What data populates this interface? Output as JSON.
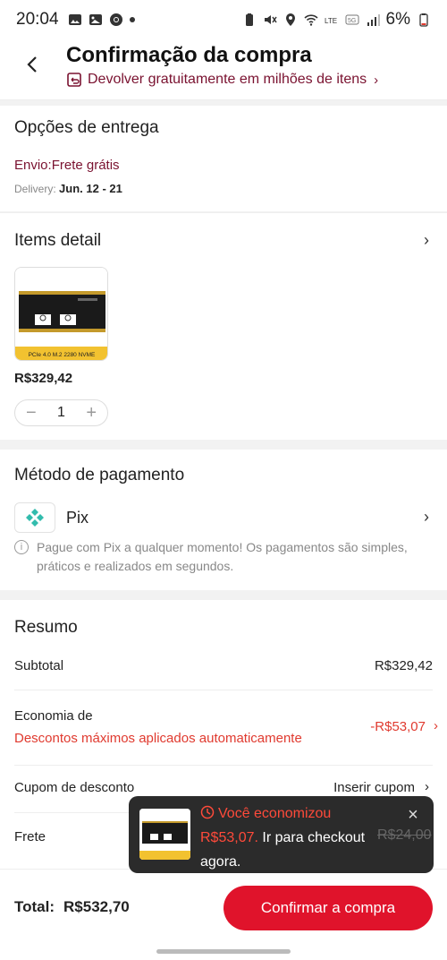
{
  "status_bar": {
    "time": "20:04",
    "battery": "6%"
  },
  "header": {
    "title": "Confirmação da compra",
    "return_text": "Devolver gratuitamente em milhões de itens"
  },
  "delivery": {
    "title": "Opções de entrega",
    "shipping": "Envio:Frete grátis",
    "delivery_label": "Delivery:",
    "delivery_dates": "Jun. 12 - 21"
  },
  "items": {
    "title": "Items detail",
    "price": "R$329,42",
    "quantity": "1",
    "product_badge": "PCIe 4.0 M.2 2280 NVME"
  },
  "payment": {
    "title": "Método de pagamento",
    "method": "Pix",
    "note": "Pague com Pix a qualquer momento! Os pagamentos são simples, práticos e realizados em segundos."
  },
  "summary": {
    "title": "Resumo",
    "subtotal_label": "Subtotal",
    "subtotal_value": "R$329,42",
    "savings_label": "Economia de",
    "savings_sub": "Descontos máximos aplicados automaticamente",
    "savings_value": "-R$53,07",
    "coupon_label": "Cupom de desconto",
    "coupon_value": "Inserir cupom",
    "shipping_label": "Frete",
    "shipping_strike": "R$24,00"
  },
  "toast": {
    "headline": "Você economizou",
    "amount": "R$53,07.",
    "text": "Ir para checkout agora."
  },
  "bottom": {
    "total_label": "Total:",
    "total_value": "R$532,70",
    "confirm_label": "Confirmar a compra"
  },
  "colors": {
    "accent": "#e0132b",
    "maroon": "#7a1230",
    "saving_red": "#e03a2f",
    "pix_teal": "#32bcad"
  }
}
